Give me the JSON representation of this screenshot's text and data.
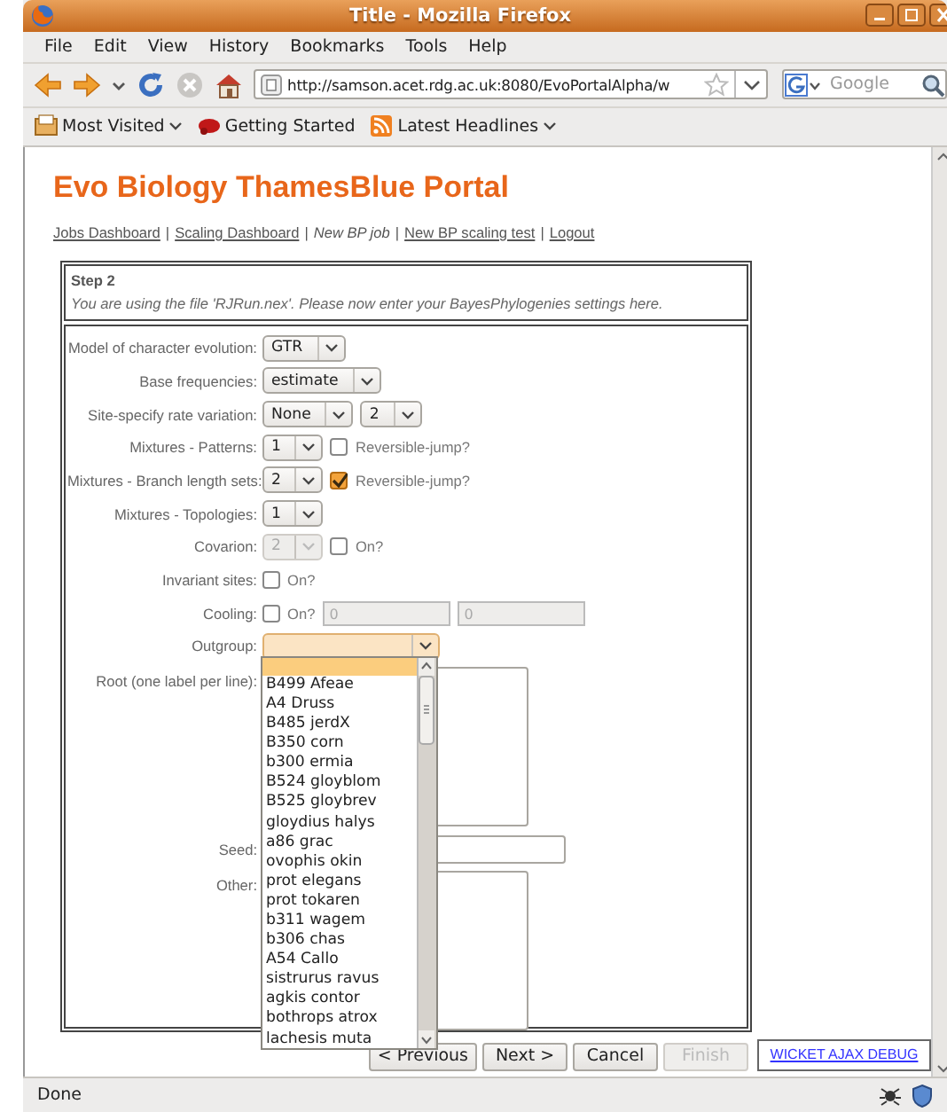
{
  "window": {
    "title": "Title - Mozilla Firefox"
  },
  "menu": [
    "File",
    "Edit",
    "View",
    "History",
    "Bookmarks",
    "Tools",
    "Help"
  ],
  "toolbar": {
    "url": "http://samson.acet.rdg.ac.uk:8080/EvoPortalAlpha/w",
    "search": {
      "placeholder": "Google"
    }
  },
  "bookmarks": [
    {
      "kind": "folder",
      "label": "Most Visited",
      "menu": true
    },
    {
      "kind": "page",
      "label": "Getting Started",
      "menu": false
    },
    {
      "kind": "feed",
      "label": "Latest Headlines",
      "menu": true
    }
  ],
  "page": {
    "title": "Evo Biology ThamesBlue Portal",
    "links": [
      {
        "label": "Jobs Dashboard",
        "selected": false
      },
      {
        "label": "Scaling Dashboard",
        "selected": false,
        "separator": "|"
      },
      {
        "label": "New BP job",
        "selected": true,
        "separator": "|"
      },
      {
        "label": "New BP scaling test",
        "selected": false,
        "separator": "|"
      },
      {
        "label": "Logout",
        "selected": false,
        "separator": "|"
      }
    ]
  },
  "step": {
    "heading": "Step 2",
    "message": "You are using the file 'RJRun.nex'. Please now enter your BayesPhylogenies settings here."
  },
  "form": {
    "rows": [
      {
        "kind": "controls",
        "label": "Model of character evolution:",
        "selects": [
          {
            "value": "GTR",
            "disabled": false
          }
        ]
      },
      {
        "kind": "controls",
        "label": "Base frequencies:",
        "selects": [
          {
            "value": "estimate",
            "disabled": false
          }
        ]
      },
      {
        "kind": "controls",
        "label": "Site-specify rate variation:",
        "selects": [
          {
            "value": "None",
            "disabled": false
          },
          {
            "value": "2",
            "disabled": false
          }
        ]
      },
      {
        "kind": "controls",
        "label": "Mixtures - Patterns:",
        "selects": [
          {
            "value": "1",
            "disabled": false
          }
        ],
        "checkbox": {
          "label": "Reversible-jump?",
          "checked": false
        }
      },
      {
        "kind": "controls",
        "label": "Mixtures - Branch length sets:",
        "selects": [
          {
            "value": "2",
            "disabled": false
          }
        ],
        "checkbox": {
          "label": "Reversible-jump?",
          "checked": true
        }
      },
      {
        "kind": "controls",
        "label": "Mixtures - Topologies:",
        "selects": [
          {
            "value": "1",
            "disabled": false
          }
        ]
      },
      {
        "kind": "controls",
        "label": "Covarion:",
        "selects": [
          {
            "value": "2",
            "disabled": true
          }
        ],
        "checkbox": {
          "label": "On?",
          "checked": false
        }
      },
      {
        "kind": "controls",
        "label": "Invariant sites:",
        "checkbox": {
          "label": "On?",
          "checked": false
        }
      },
      {
        "kind": "controls",
        "label": "Cooling:",
        "checkbox": {
          "label": "On?",
          "checked": false
        },
        "inputs": [
          {
            "value": "0",
            "disabled": true
          },
          {
            "value": "0",
            "disabled": true
          }
        ]
      },
      {
        "kind": "controls",
        "label": "Outgroup:",
        "selects": [
          {
            "expanded": true,
            "disabled": false
          }
        ]
      },
      {
        "kind": "textarea",
        "label": "Root (one label per line):"
      },
      {
        "kind": "input",
        "label": "Seed:"
      },
      {
        "kind": "textarea",
        "label": "Other:"
      }
    ]
  },
  "outgroup_list": {
    "blank_highlighted": true,
    "options": [
      "B499 Afeae",
      "A4 Druss",
      "B485 jerdX",
      "B350 corn",
      "b300 ermia",
      "B524 gloyblom",
      "B525 gloybrev",
      "gloydius halys",
      "a86 grac",
      "ovophis okin",
      "prot elegans",
      "prot tokaren",
      "b311 wagem",
      "b306 chas",
      "A54 Callo",
      "sistrurus ravus",
      "agkis contor",
      "bothrops atrox",
      "lachesis muta"
    ]
  },
  "buttons": [
    {
      "label": "< Previous",
      "disabled": false
    },
    {
      "label": "Next >",
      "disabled": false
    },
    {
      "label": "Cancel",
      "disabled": false
    },
    {
      "label": "Finish",
      "disabled": true
    }
  ],
  "debug_link": "WICKET AJAX DEBUG",
  "status_bar": "Done"
}
